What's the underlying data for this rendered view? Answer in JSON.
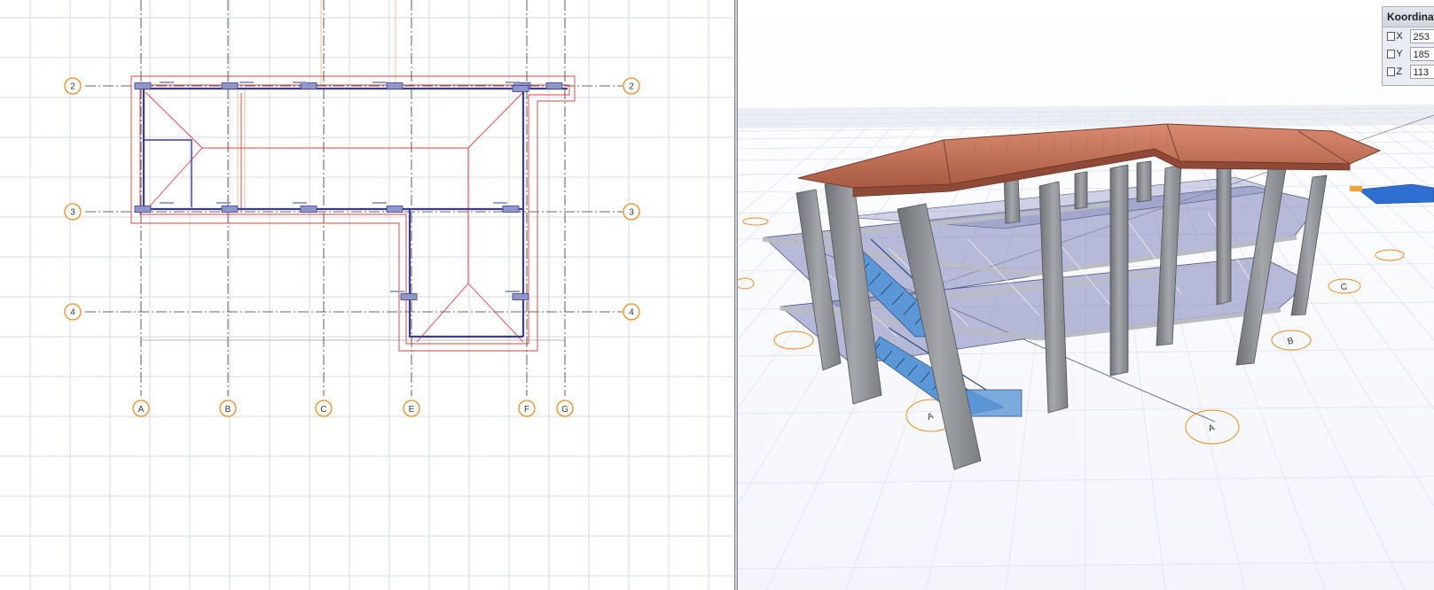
{
  "coordinates_panel": {
    "title": "Koordinat",
    "rows": [
      {
        "axis": "X",
        "value": "253",
        "checked": false
      },
      {
        "axis": "Y",
        "value": "185",
        "checked": false
      },
      {
        "axis": "Z",
        "value": "113",
        "checked": false
      }
    ]
  },
  "plan_view": {
    "row_axes": [
      "2",
      "3",
      "4"
    ],
    "column_axes": [
      "A",
      "B",
      "C",
      "E",
      "F",
      "G"
    ]
  },
  "view_3d": {
    "axis_bubbles": [
      "A",
      "A",
      "B",
      "C"
    ]
  },
  "colors": {
    "grid": "#d5dae6",
    "axis_bubble": "#f08a24",
    "roof_outline": "#e03c3c",
    "beam": "#3a3a9a",
    "column_fill": "#8f96c8",
    "roof_3d": "#c9735a",
    "concrete": "#8e9296",
    "slab": "#7e84b8",
    "stair": "#5b97d6"
  }
}
